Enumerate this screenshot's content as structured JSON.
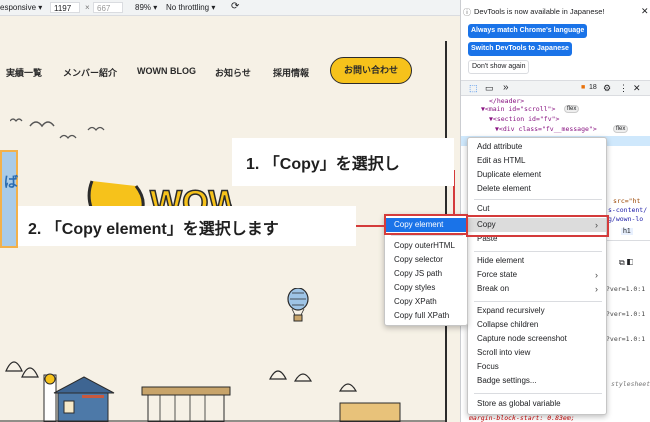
{
  "device_toolbar": {
    "mode": "esponsive",
    "width": "1197",
    "times": "×",
    "height": "667",
    "zoom": "89%",
    "throttling": "No throttling"
  },
  "site": {
    "nav": [
      "実績一覧",
      "メンバー紹介",
      "WOWN BLOG",
      "お知らせ",
      "採用情報"
    ],
    "contact": "お問い合わせ",
    "logo": "WOWN",
    "side_char": "ば"
  },
  "devtools": {
    "notice": "DevTools is now available in Japanese!",
    "btn_match": "Always match Chrome's language",
    "btn_switch": "Switch DevTools to Japanese",
    "btn_dont": "Don't show again",
    "issues": "18",
    "code_lines": [
      "</header>",
      "▼<main id=\"scroll\">",
      "▼<section id=\"fv\">",
      "▼<div class=\"fv__message\">"
    ],
    "badge_flex": "flex",
    "code_right": [
      "src=\"ht",
      "s-content/",
      "g/wown-lo"
    ],
    "h1_badge": "h1",
    "ver": "?ver=1.0:1",
    "stylesheet": "stylesheet",
    "margin_line": "margin-block-start: 0.83em;"
  },
  "context_menu": {
    "items": [
      "Add attribute",
      "Edit as HTML",
      "Duplicate element",
      "Delete element",
      "Cut",
      "Copy",
      "Paste",
      "Hide element",
      "Force state",
      "Break on",
      "Expand recursively",
      "Collapse children",
      "Capture node screenshot",
      "Scroll into view",
      "Focus",
      "Badge settings...",
      "Store as global variable"
    ]
  },
  "copy_submenu": {
    "items": [
      "Copy element",
      "Copy outerHTML",
      "Copy selector",
      "Copy JS path",
      "Copy styles",
      "Copy XPath",
      "Copy full XPath"
    ]
  },
  "callouts": {
    "step1": "1. 「Copy」を選択し",
    "step2": "2. 「Copy element」を選択します"
  }
}
